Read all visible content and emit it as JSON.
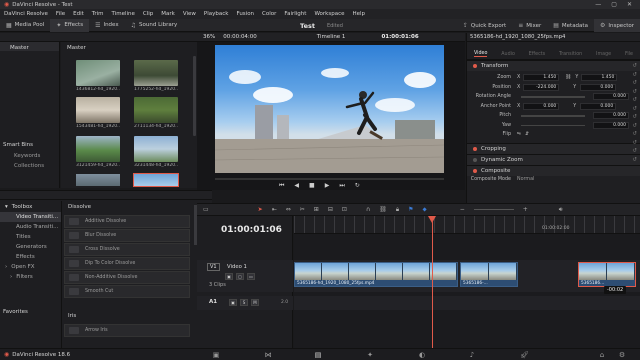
{
  "window": {
    "title": "DaVinci Resolve - Test",
    "controls": [
      "—",
      "▢",
      "✕"
    ]
  },
  "menu": [
    "DaVinci Resolve",
    "File",
    "Edit",
    "Trim",
    "Timeline",
    "Clip",
    "Mark",
    "View",
    "Playback",
    "Fusion",
    "Color",
    "Fairlight",
    "Workspace",
    "Help"
  ],
  "toolbar": {
    "media_pool": "Media Pool",
    "effects": "Effects",
    "index": "Index",
    "sound_library": "Sound Library",
    "project_name": "Test",
    "project_status": "Edited",
    "quick_export": "Quick Export",
    "mixer": "Mixer",
    "metadata": "Metadata",
    "inspector": "Inspector"
  },
  "viewer_bar": {
    "zoom": "36%",
    "source_tc": "00:00:04:00",
    "timeline_name": "Timeline 1",
    "record_tc": "01:00:01:06"
  },
  "inspector": {
    "clip_name": "5365186-hd_1920_1080_25fps.mp4",
    "tabs": [
      "Video",
      "Audio",
      "Effects",
      "Transition",
      "Image",
      "File"
    ],
    "transform_title": "Transform",
    "zoom_label": "Zoom",
    "zoom_x": "1.450",
    "zoom_y": "1.450",
    "position_label": "Position",
    "pos_x": "-224.000",
    "pos_y": "0.000",
    "rotation_label": "Rotation Angle",
    "rotation": "0.000",
    "anchor_label": "Anchor Point",
    "anchor_x": "0.000",
    "anchor_y": "0.000",
    "pitch_label": "Pitch",
    "pitch": "0.000",
    "yaw_label": "Yaw",
    "yaw": "0.000",
    "flip_label": "Flip",
    "x_label": "X",
    "y_label": "Y",
    "cropping": "Cropping",
    "dynamic_zoom": "Dynamic Zoom",
    "composite": "Composite",
    "composite_mode_label": "Composite Mode",
    "composite_mode": "Normal"
  },
  "left": {
    "master_header": "Master",
    "smart_bins": "Smart Bins",
    "keywords": "Keywords",
    "collections": "Collections",
    "toolbox": "Toolbox",
    "tree": [
      "Video Transiti...",
      "Audio Transiti...",
      "Titles",
      "Generators",
      "Effects"
    ],
    "open_fx": "Open FX",
    "filters": "Filters",
    "favorites": "Favorites"
  },
  "media_pool": {
    "header": "Master",
    "clips": [
      "1436812-hd_1920...",
      "1775252-hd_1920...",
      "1543481-hd_1920...",
      "2711134-hd_1920...",
      "3121459-hd_1920...",
      "3231448-hd_1920...",
      "",
      ""
    ]
  },
  "effects": {
    "dissolve_header": "Dissolve",
    "items": [
      "Additive Dissolve",
      "Blur Dissolve",
      "Cross Dissolve",
      "Dip To Color Dissolve",
      "Non-Additive Dissolve",
      "Smooth Cut"
    ],
    "iris_header": "Iris",
    "iris_items": [
      "Arrow Iris"
    ]
  },
  "timeline": {
    "timecode": "01:00:01:06",
    "ruler_mark": "01:00:02:00",
    "v1_tag": "V1",
    "v1_name": "Video 1",
    "v1_count": "3 Clips",
    "a1_tag": "A1",
    "a1_level": "2.0",
    "clip1": "5365186-hd_1920_1080_25fps.mp4",
    "clip2": "5365186-...",
    "clip3": "5365186...",
    "trim_badge": "-00:02"
  },
  "footer": {
    "app_name": "DaVinci Resolve 18.6"
  },
  "colors": {
    "accent_red": "#e05a4a",
    "clip_blue": "#2d4d73",
    "playhead": "#e05a4a"
  }
}
